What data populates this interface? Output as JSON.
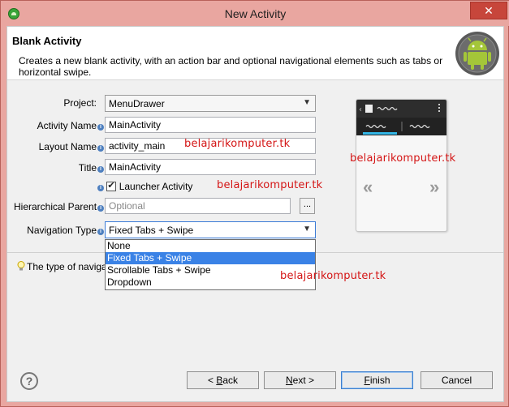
{
  "window": {
    "title": "New Activity",
    "close_glyph": "✕"
  },
  "header": {
    "title": "Blank Activity",
    "description": "Creates a new blank activity, with an action bar and optional navigational elements such as tabs or horizontal swipe."
  },
  "form": {
    "project": {
      "label": "Project:",
      "value": "MenuDrawer"
    },
    "activity_name": {
      "label": "Activity Name",
      "value": "MainActivity"
    },
    "layout_name": {
      "label": "Layout Name",
      "value": "activity_main"
    },
    "title": {
      "label": "Title",
      "value": "MainActivity"
    },
    "launcher": {
      "label": "Launcher Activity",
      "checked": true
    },
    "hierarchical_parent": {
      "label": "Hierarchical Parent",
      "placeholder": "Optional",
      "browse": "..."
    },
    "navigation_type": {
      "label": "Navigation Type",
      "value": "Fixed Tabs + Swipe",
      "options": [
        "None",
        "Fixed Tabs + Swipe",
        "Scrollable Tabs + Swipe",
        "Dropdown"
      ],
      "selected_index": 1
    }
  },
  "watermarks": [
    "belajarikomputer.tk",
    "belajarikomputer.tk",
    "belajarikomputer.tk",
    "belajarikomputer.tk"
  ],
  "hint": "The type of naviga",
  "preview": {
    "left_arrow": "«",
    "right_arrow": "»"
  },
  "footer": {
    "back_pre": "< ",
    "back_u": "B",
    "back_post": "ack",
    "next_u": "N",
    "next_post": "ext >",
    "finish_u": "F",
    "finish_post": "inish",
    "cancel": "Cancel",
    "help_glyph": "?"
  },
  "colors": {
    "accent": "#3a82e6",
    "watermark": "#d41515",
    "android": "#a4c639"
  }
}
